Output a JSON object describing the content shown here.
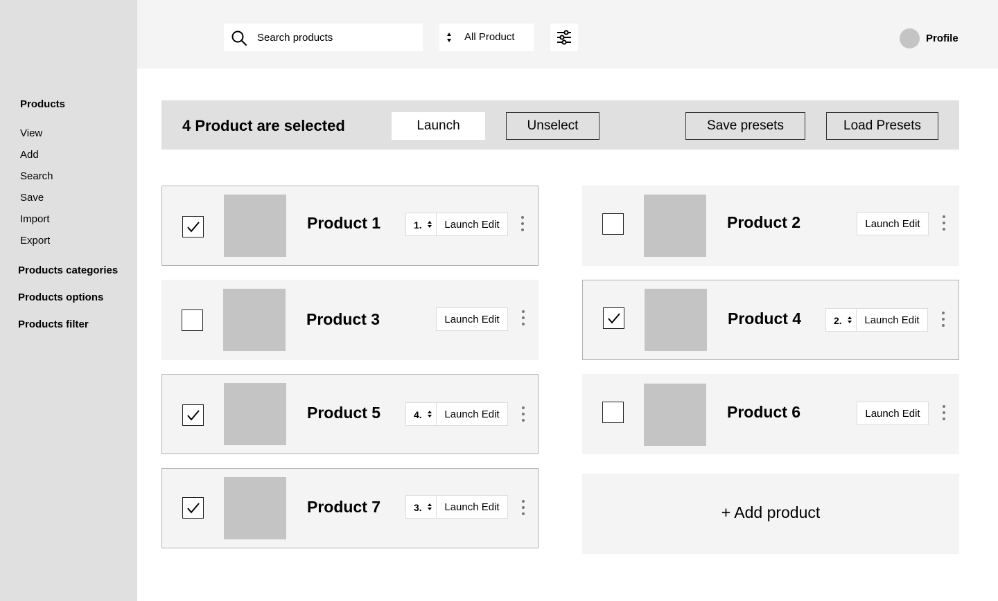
{
  "sidebar": {
    "sections": [
      {
        "title": "Products",
        "items": [
          "View",
          "Add",
          "Search",
          "Save",
          "Import",
          "Export"
        ]
      },
      {
        "title": "Products categories"
      },
      {
        "title": "Products options"
      },
      {
        "title": "Products filter"
      }
    ]
  },
  "topbar": {
    "search_placeholder": "Search products",
    "select_value": "All Product",
    "profile_label": "Profile"
  },
  "selection_bar": {
    "text": "4 Product are selected",
    "launch_label": "Launch",
    "unselect_label": "Unselect",
    "save_presets_label": "Save presets",
    "load_presets_label": "Load Presets"
  },
  "products": [
    {
      "name": "Product 1",
      "checked": true,
      "order": "1.",
      "action": "Launch Edit"
    },
    {
      "name": "Product 2",
      "checked": false,
      "order": "",
      "action": "Launch Edit"
    },
    {
      "name": "Product 3",
      "checked": false,
      "order": "",
      "action": "Launch Edit"
    },
    {
      "name": "Product 4",
      "checked": true,
      "order": "2.",
      "action": "Launch Edit"
    },
    {
      "name": "Product 5",
      "checked": true,
      "order": "4.",
      "action": "Launch Edit"
    },
    {
      "name": "Product 6",
      "checked": false,
      "order": "",
      "action": "Launch Edit"
    },
    {
      "name": "Product 7",
      "checked": true,
      "order": "3.",
      "action": "Launch Edit"
    }
  ],
  "add_product_label": "+ Add product",
  "colors": {
    "sidebar_bg": "#e0e0e0",
    "topbar_bg": "#f4f4f4",
    "card_bg": "#f4f4f4",
    "thumb": "#c4c4c4"
  }
}
